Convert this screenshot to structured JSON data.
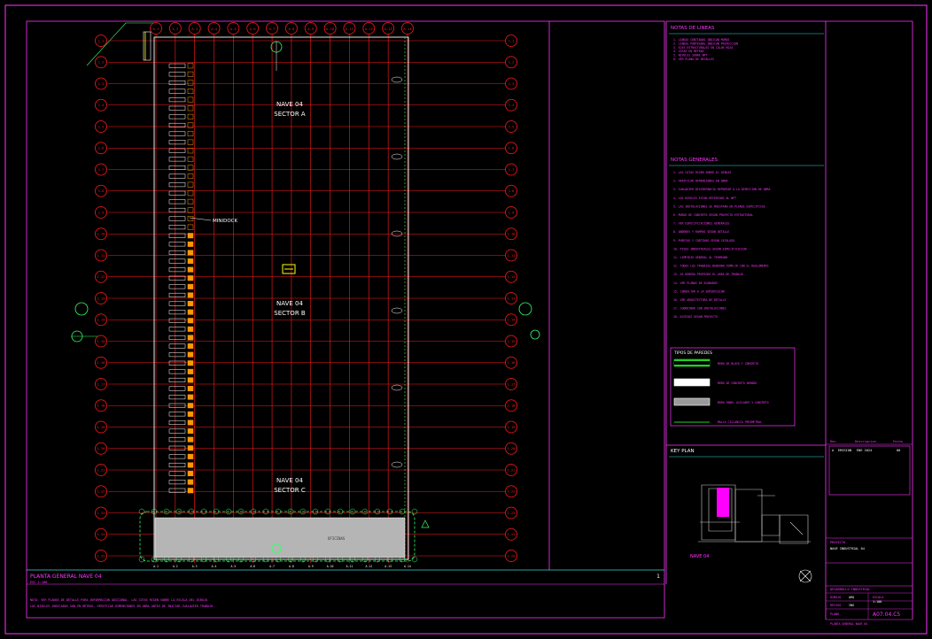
{
  "drawing": {
    "plan_title": "PLANTA GENERAL NAVE 04",
    "plan_scale": "ESC 1:100",
    "sheet_number": "1",
    "zones": [
      {
        "name": "NAVE 04",
        "sector": "SECTOR A"
      },
      {
        "name": "NAVE 04",
        "sector": "SECTOR B"
      },
      {
        "name": "NAVE 04",
        "sector": "SECTOR C"
      }
    ],
    "minidock_label": "MINIDOCK",
    "column_grid_labels": [
      "A.1",
      "A.2",
      "A.3",
      "A.4",
      "A.5",
      "A.6",
      "A.7",
      "A.8",
      "A.9",
      "A.10",
      "A.11",
      "A.12",
      "A.13",
      "A.14"
    ],
    "row_grid_labels": [
      "1.1",
      "1.2",
      "1.3",
      "1.4",
      "1.5",
      "1.6",
      "1.7",
      "1.8",
      "1.9",
      "1.10",
      "1.11",
      "1.12",
      "1.13",
      "1.14",
      "1.15",
      "1.16",
      "1.17",
      "1.18",
      "1.19",
      "1.20",
      "1.21",
      "1.22",
      "1.23",
      "1.24",
      "1.25"
    ],
    "office_area_label": "OFICINAS",
    "bottom_notes_line1": "NOTA: VER PLANOS DE DETALLE PARA INFORMACION ADICIONAL. LAS COTAS RIGEN SOBRE LA ESCALA DEL DIBUJO.",
    "bottom_notes_line2": "LOS NIVELES INDICADOS SON EN METROS. VERIFICAR DIMENSIONES EN OBRA ANTES DE INICIAR CUALQUIER TRABAJO."
  },
  "right_panel": {
    "notas_lineas_title": "NOTAS DE LINEAS",
    "notas_lineas_items": [
      "1. LINEAS CONTINUAS INDICAN MUROS",
      "2. LINEAS PUNTEADAS INDICAN PROYECCION",
      "3. EJES ESTRUCTURALES EN COLOR ROJO",
      "4. COTAS EN METROS",
      "5. NIVELES SOBRE NPT",
      "6. VER PLANO DE DETALLES"
    ],
    "notas_generales_title": "NOTAS GENERALES",
    "notas_generales_items": [
      "1. LAS COTAS RIGEN SOBRE EL DIBUJO",
      "2. VERIFICAR DIMENSIONES EN OBRA",
      "3. CUALQUIER DISCREPANCIA REPORTAR A LA DIRECCION DE OBRA",
      "4. LOS NIVELES ESTAN REFERIDOS AL NPT",
      "5. LAS INSTALACIONES SE MUESTRAN EN PLANOS ESPECIFICOS",
      "6. MUROS DE CONCRETO SEGUN PROYECTO ESTRUCTURAL",
      "7. VER ESPECIFICACIONES GENERALES",
      "8. ANDENES Y RAMPAS SEGUN DETALLE",
      "9. PUERTAS Y CORTINAS SEGUN CATALOGO",
      "10. PISOS INDUSTRIALES SEGUN ESPECIFICACION",
      "11. LIMPIEZA GENERAL AL TERMINAR",
      "12. TODOS LOS TRABAJOS DEBERAN CUMPLIR CON EL REGLAMENTO",
      "13. SE DEBERA PROTEGER EL AREA DE TRABAJO",
      "14. VER PLANOS DE ACABADOS",
      "15. CONSULTAR A LA SUPERVISION",
      "16. VER ARQUITECTURA DE DETALLE",
      "17. COORDINAR CON INSTALACIONES",
      "18. ACCESOS SEGUN PROYECTO"
    ],
    "tipos_paredes_title": "TIPOS DE PAREDES",
    "tipos_paredes_items": [
      {
        "label": "MURO DE BLOCK Y CONCRETO",
        "color": "#22d122"
      },
      {
        "label": "MURO DE CONCRETO ARMADO",
        "color": "#ffffff"
      },
      {
        "label": "MURO PANEL AISLANTE Y CONCRETO",
        "color": "#9a9a9a"
      },
      {
        "label": "MALLA CICLONICA PERIMETRAL",
        "color": "#22d122"
      }
    ],
    "key_plan_title": "KEY PLAN",
    "key_plan_label": "NAVE 04"
  },
  "title_block": {
    "rev_header": [
      "Rev",
      "Descripcion",
      "Fecha"
    ],
    "rev_row": [
      "A",
      "EMISION",
      "ENE 2024",
      "00"
    ],
    "project_label": "PROYECTO",
    "project_name": "NAVE INDUSTRIAL 04",
    "company": "DESARROLLO INDUSTRIAL",
    "drawn_label": "DIBUJO",
    "drawn_value": "ARQ",
    "check_label": "REVISO",
    "check_value": "ING",
    "scale_label": "ESCALA",
    "scale_value": "1:100",
    "sheet_label": "PLANO",
    "sheet_code": "A07.04.C5",
    "bottom_text": "PLANTA GENERAL NAVE 04"
  },
  "colors": {
    "grid": "#ff1a1a",
    "frame": "#ff33ff",
    "text": "#ffffff",
    "accent_green": "#33ff66",
    "cyan": "#33dddd",
    "yellow": "#ffff00",
    "orange": "#ff9900",
    "magenta": "#ff00ff"
  }
}
